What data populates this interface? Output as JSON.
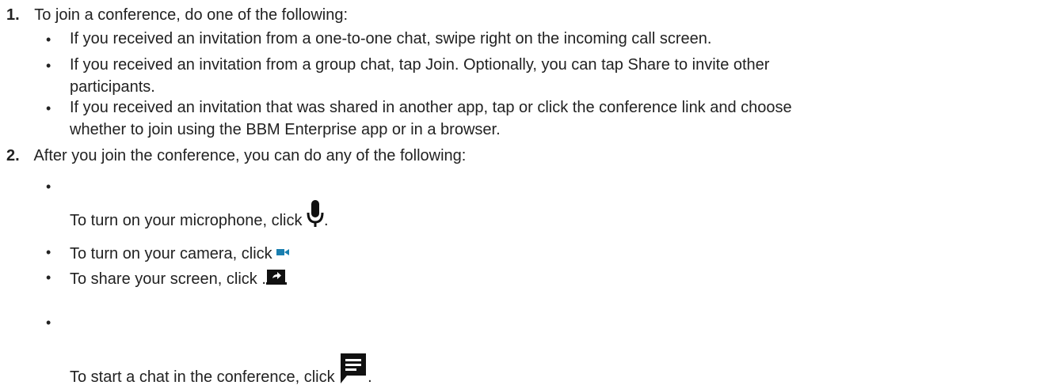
{
  "steps": [
    {
      "number": "1.",
      "text": "To join a conference, do one of the following:",
      "bullets": [
        {
          "line1": " If you received an invitation from a one-to-one chat, swipe right on the incoming call screen."
        },
        {
          "line1": " If you received an invitation from a group chat, tap Join. Optionally, you can tap Share to invite other",
          "line2": "participants."
        },
        {
          "line1": " If you received an invitation that was shared in another app, tap or click the conference link and choose",
          "line2": "whether to join using the BBM Enterprise app or in a browser."
        }
      ]
    },
    {
      "number": "2.",
      "text": "After you join the conference, you can do any of the following:",
      "bullets": [
        {
          "text": "To turn on your microphone, click ",
          "icon": "microphone-icon",
          "after": "."
        },
        {
          "text": "To turn on your camera, click ",
          "icon": "video-camera-icon"
        },
        {
          "text": "To share your screen, click .",
          "icon": "share-screen-icon"
        },
        {
          "text": "To start a chat in the conference, click ",
          "icon": "chat-icon",
          "after": "."
        }
      ]
    }
  ],
  "colors": {
    "text": "#222222",
    "camera_icon": "#1a7fb0",
    "icon_dark": "#111111"
  }
}
